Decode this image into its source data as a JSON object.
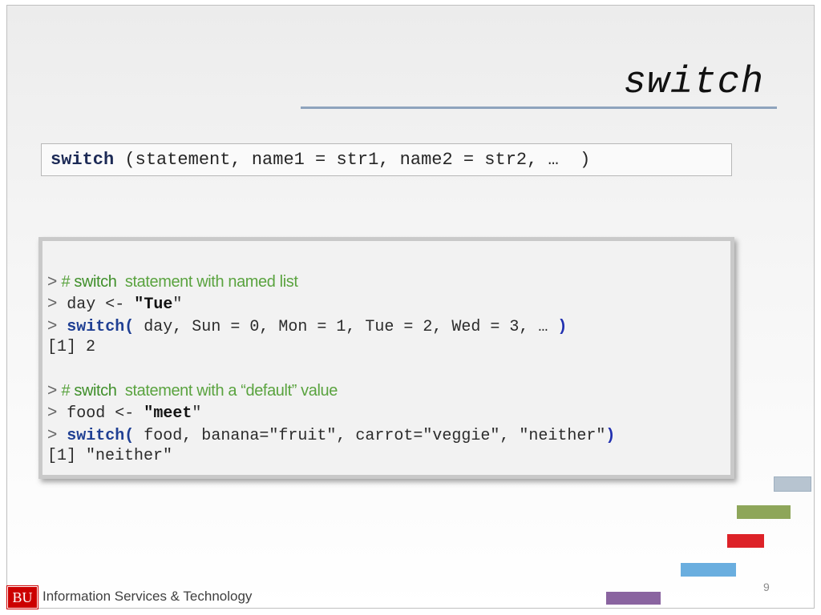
{
  "slide": {
    "title": "switch",
    "page_number": "9"
  },
  "syntax": {
    "keyword": "switch",
    "rest": " (statement, name1 = str1, name2 = str2, …  )"
  },
  "code": {
    "prompt": ">",
    "comment_hash": "#",
    "comment1_kw": "switch",
    "comment1_rest": "statement with named list",
    "line2_pre": "day <- ",
    "line2_q1": "\"",
    "line2_val": "Tue",
    "line2_q2": "\"",
    "line3_fn": "switch(",
    "line3_args": " day, Sun = 0, Mon = 1, Tue = 2, Wed = 3, … ",
    "line3_close": ")",
    "output1": "[1] 2",
    "comment2_kw": "switch",
    "comment2_rest": "statement with a “default” value",
    "line6_pre": "food <- ",
    "line6_q1": "\"",
    "line6_val": "meet",
    "line6_q2": "\"",
    "line7_fn": "switch(",
    "line7_args": " food, banana=\"fruit\", carrot=\"veggie\", \"neither\"",
    "line7_close": ")",
    "output2": "[1] \"neither\""
  },
  "footer": {
    "logo_text": "BU",
    "org_name": "Information Services & Technology"
  },
  "colors": {
    "bar_gray": "#b7c4d0",
    "bar_green": "#8ea65a",
    "bar_red": "#dd2228",
    "bar_blue": "#6aaedf",
    "bar_purple": "#8a64a0",
    "logo_red": "#cc0000"
  }
}
